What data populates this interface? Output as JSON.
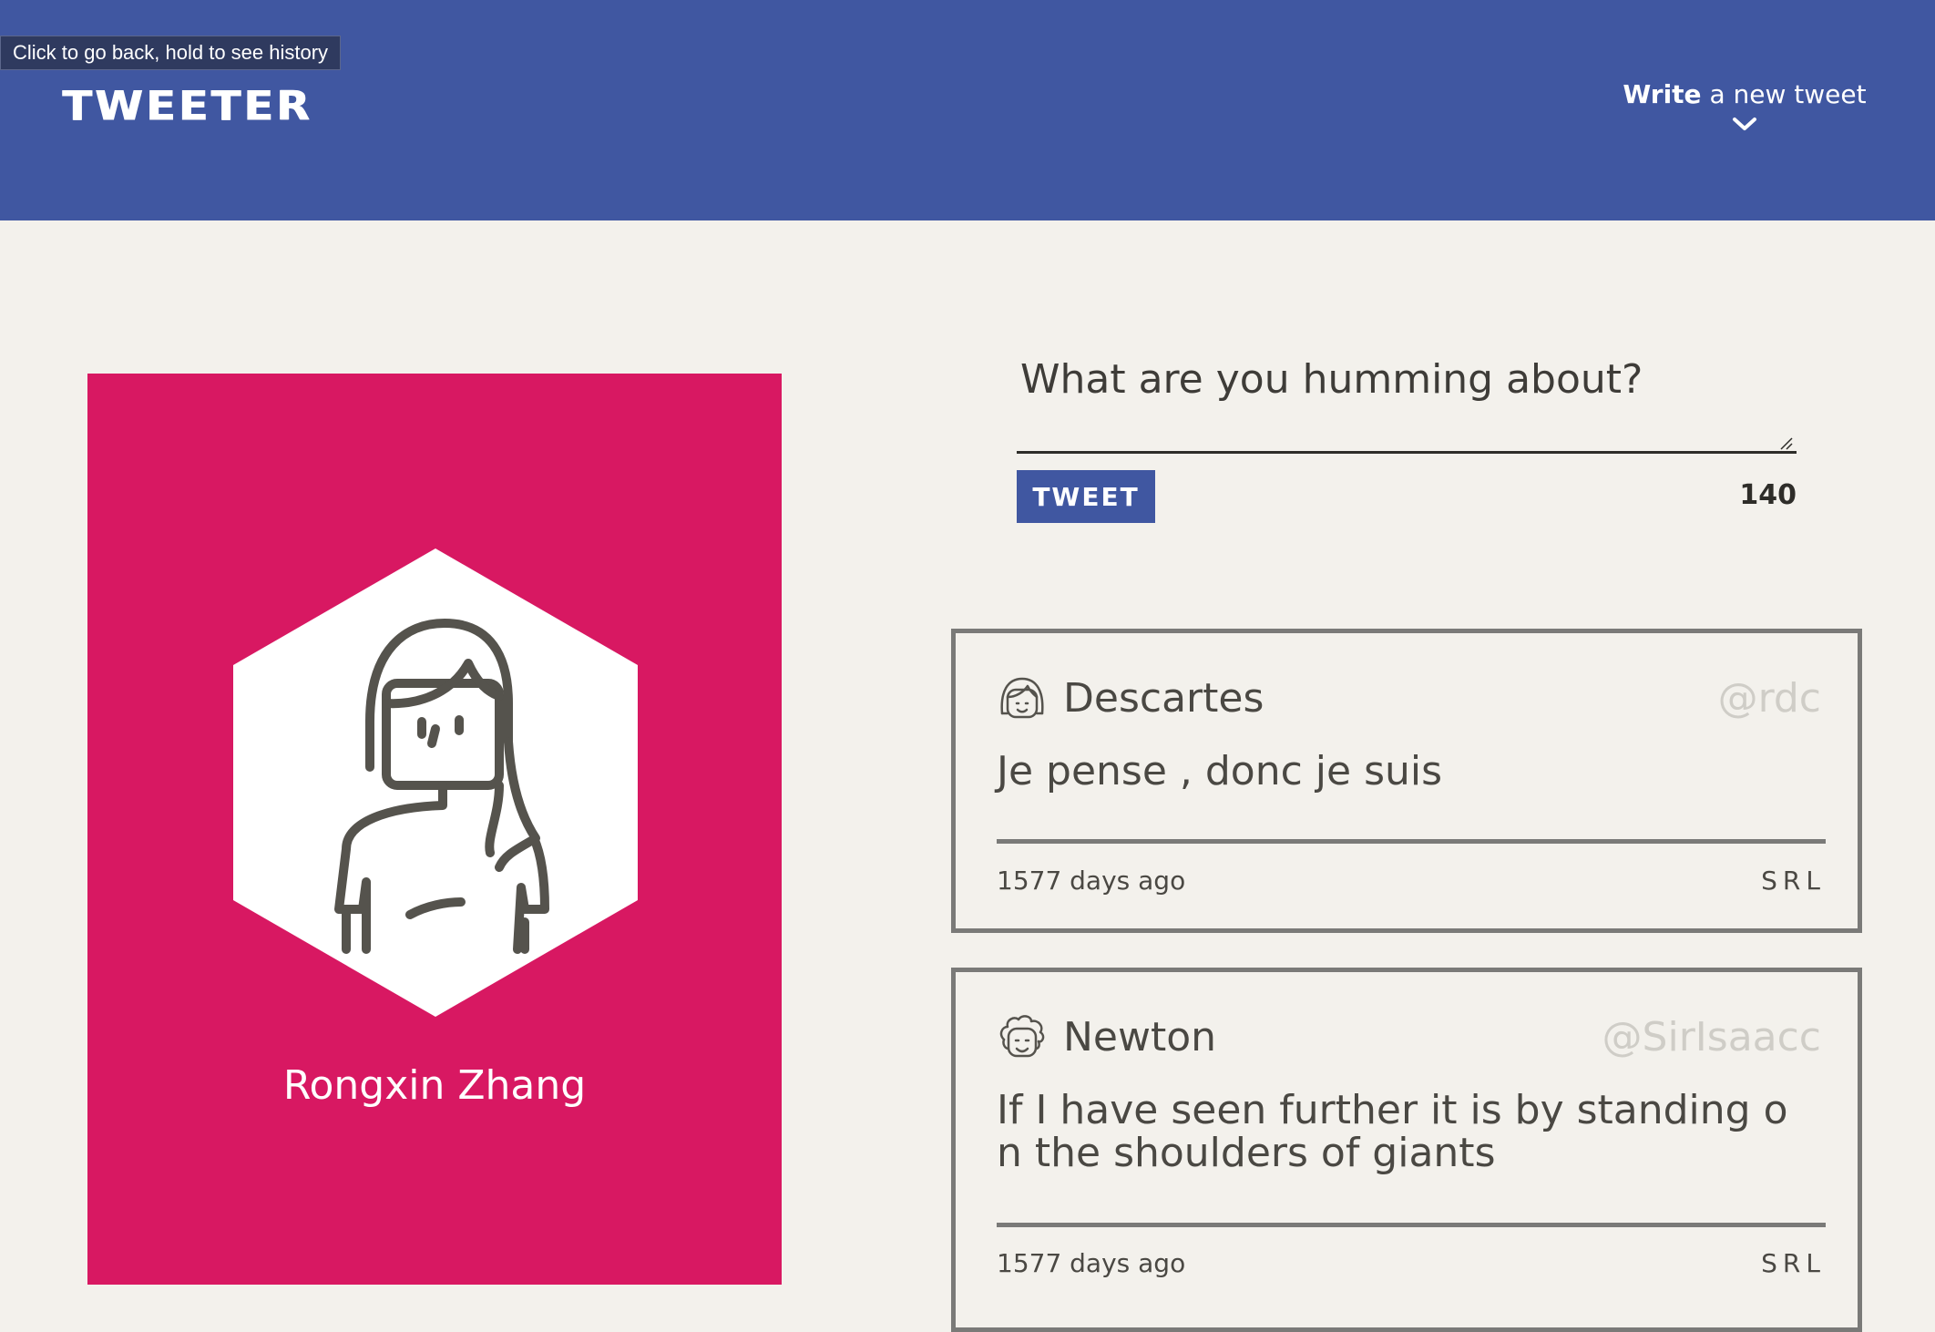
{
  "browser": {
    "back_tooltip": "Click to go back, hold to see history"
  },
  "header": {
    "logo": "TWEETER",
    "compose_toggle": {
      "bold": "Write",
      "rest": " a new tweet",
      "icon": "chevron-down-icon"
    }
  },
  "profile": {
    "name": "Rongxin Zhang",
    "avatar_icon": "woman-avatar-icon",
    "accent_color": "#d81862"
  },
  "composer": {
    "placeholder": "What are you humming about?",
    "value": "",
    "submit_label": "TWEET",
    "char_counter": "140"
  },
  "tweets": [
    {
      "author": "Descartes",
      "handle": "@rdc",
      "avatar_icon": "girl-face-icon",
      "text": "Je pense , donc je suis",
      "time": "1577 days ago",
      "actions": [
        "S",
        "R",
        "L"
      ]
    },
    {
      "author": "Newton",
      "handle": "@SirIsaacc",
      "avatar_icon": "curly-hair-man-face-icon",
      "text": "If I have seen further it is by standing on the shoulders of giants",
      "time": "1577 days ago",
      "actions": [
        "S",
        "R",
        "L"
      ]
    }
  ],
  "colors": {
    "nav_blue": "#4057a1",
    "page_bg": "#f3f1ec",
    "profile_pink": "#d81862",
    "card_border": "#7a7a78",
    "handle_gray": "#cfcdc7"
  }
}
